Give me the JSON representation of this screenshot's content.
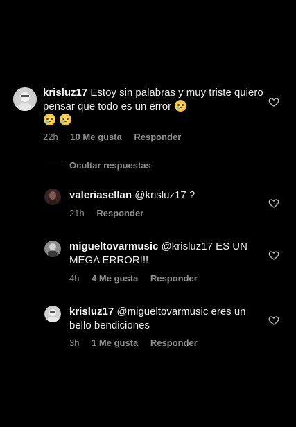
{
  "comment": {
    "username": "krisluz17",
    "text": "Estoy sin palabras y muy triste quiero pensar que todo es un error",
    "time": "22h",
    "likes": "10 Me gusta",
    "reply": "Responder"
  },
  "toggle": {
    "label": "Ocultar respuestas"
  },
  "replies": [
    {
      "username": "valeriasellan",
      "text": "@krisluz17 ?",
      "time": "21h",
      "likes": "",
      "reply": "Responder"
    },
    {
      "username": "migueltovarmusic",
      "text": "@krisluz17 ES UN MEGA ERROR!!!",
      "time": "4h",
      "likes": "4 Me gusta",
      "reply": "Responder"
    },
    {
      "username": "krisluz17",
      "text": "@migueltovarmusic eres un bello bendiciones",
      "time": "3h",
      "likes": "1 Me gusta",
      "reply": "Responder"
    }
  ],
  "icons": {
    "heart": "heart-outline-icon",
    "emoji": "crying-face-emoji"
  },
  "colors": {
    "background": "#000000",
    "text": "#ededed",
    "meta": "#8e8e8e"
  }
}
